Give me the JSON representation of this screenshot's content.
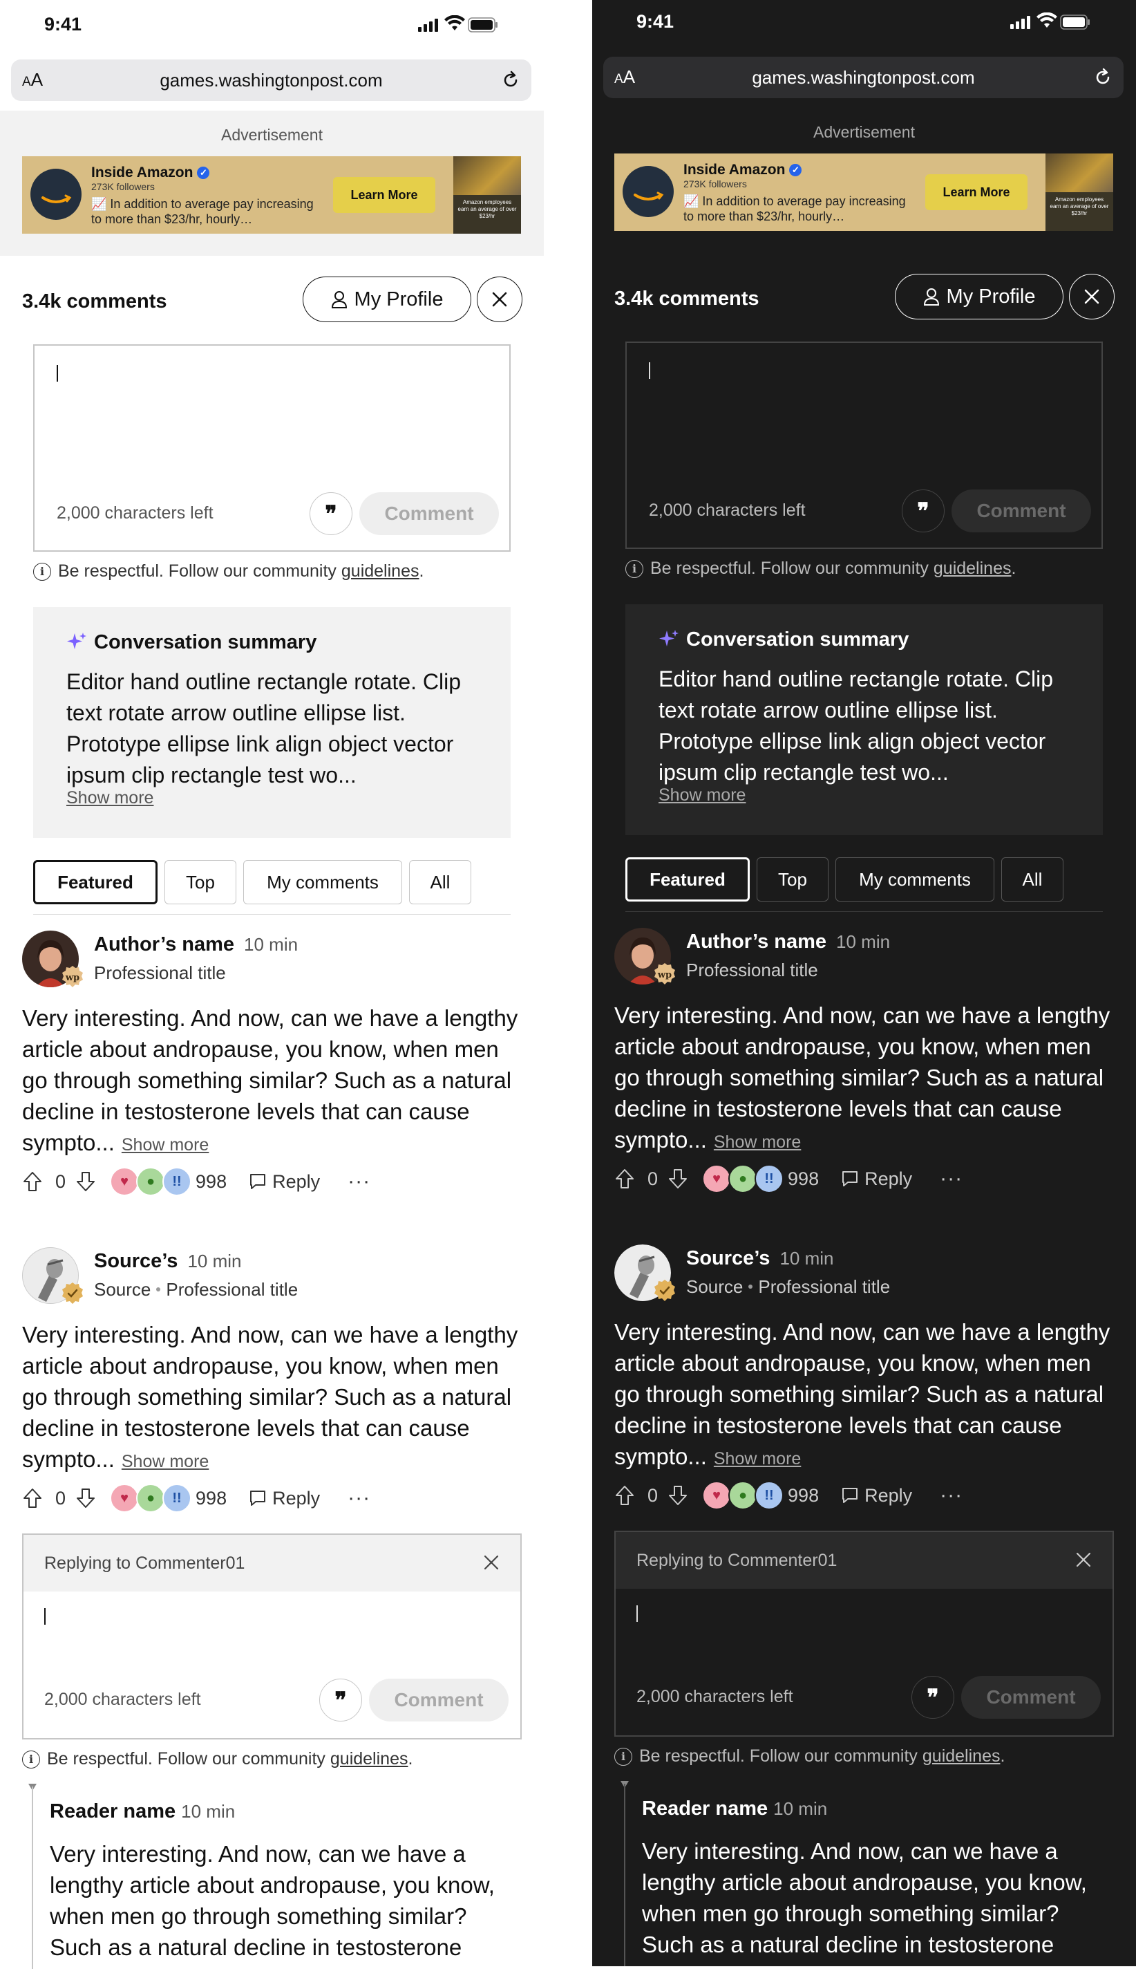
{
  "status": {
    "time": "9:41"
  },
  "browser": {
    "text_size_label": "AA",
    "url": "games.washingtonpost.com"
  },
  "ad": {
    "label": "Advertisement",
    "advertiser": "Inside Amazon",
    "followers": "273K followers",
    "text": "📈 In addition to average pay increasing to more than $23/hr, hourly…",
    "cta": "Learn More",
    "image_caption": "Amazon employees earn an average of over $23/hr"
  },
  "comments_header": {
    "count": "3.4k comments",
    "profile_label": "My Profile"
  },
  "composer": {
    "chars_left": "2,000 characters left",
    "submit_label": "Comment",
    "quote_glyph": "❞"
  },
  "guidelines": {
    "prefix": "Be respectful. Follow our community ",
    "link": "guidelines",
    "suffix": "."
  },
  "summary": {
    "title": "Conversation summary",
    "text": "Editor hand outline rectangle rotate. Clip text rotate arrow outline ellipse list. Prototype ellipse link align object vector ipsum clip rectangle test wo...",
    "show_more": "Show more"
  },
  "tabs": [
    "Featured",
    "Top",
    "My comments",
    "All"
  ],
  "comments": [
    {
      "name": "Author’s name",
      "time": "10 min",
      "role": "Professional title",
      "body": "Very interesting. And now, can we have a lengthy article about andropause, you know, when men go through something similar? Such as a natural decline in testosterone levels that can cause sympto...",
      "show_more": "Show more",
      "votes": "0",
      "reactions": "998",
      "reply_label": "Reply"
    },
    {
      "name": "Source’s",
      "time": "10 min",
      "source_label": "Source",
      "role": "Professional title",
      "body": "Very interesting. And now, can we have a lengthy article about andropause, you know, when men go through something similar? Such as a natural decline in testosterone levels that can cause sympto...",
      "show_more": "Show more",
      "votes": "0",
      "reactions": "998",
      "reply_label": "Reply"
    }
  ],
  "reply_composer": {
    "replying_to": "Replying to Commenter01",
    "chars_left": "2,000 characters left",
    "submit_label": "Comment"
  },
  "nested_reply": {
    "name": "Reader name",
    "time": "10 min",
    "body": "Very interesting. And now, can we have a lengthy article about andropause, you know, when men go through something similar? Such as a natural decline in testosterone"
  },
  "themes": {
    "light_bg": "#ffffff",
    "dark_bg": "#1b1b1b",
    "accent_sparkle": "#7b61ff"
  }
}
